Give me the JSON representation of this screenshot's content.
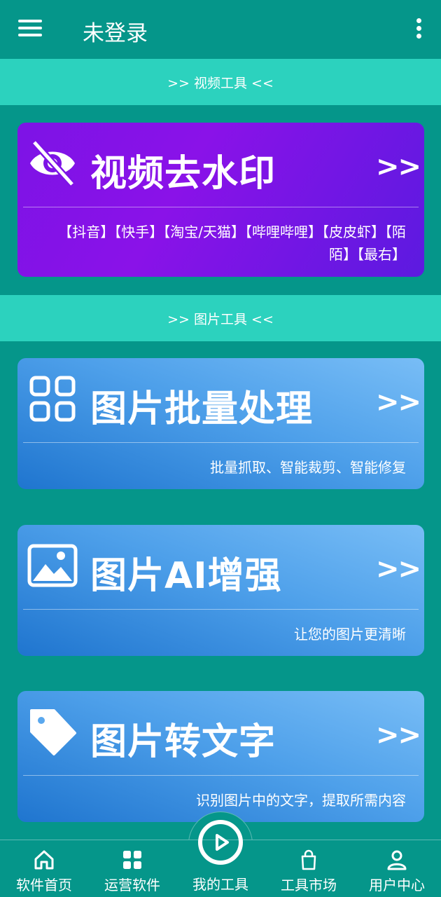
{
  "appbar": {
    "title": "未登录",
    "menu_icon": "menu-icon",
    "more_icon": "more-vert-icon"
  },
  "sections": {
    "video": ">> 视频工具 <<",
    "image": ">> 图片工具 <<"
  },
  "cards": [
    {
      "title": "视频去水印",
      "arrows": ">>",
      "subtitle": "【抖音】【快手】【淘宝/天猫】【哔哩哔哩】【皮皮虾】【陌陌】【最右】",
      "icon": "eye-off-icon"
    },
    {
      "title": "图片批量处理",
      "arrows": ">>",
      "subtitle": "批量抓取、智能裁剪、智能修复",
      "icon": "grid-icon"
    },
    {
      "title": "图片AI增强",
      "arrows": ">>",
      "subtitle": "让您的图片更清晰",
      "icon": "image-icon"
    },
    {
      "title": "图片转文字",
      "arrows": ">>",
      "subtitle": "识别图片中的文字，提取所需内容",
      "icon": "tag-icon"
    }
  ],
  "bottom_nav": {
    "items": [
      {
        "label": "软件首页",
        "icon": "home-icon"
      },
      {
        "label": "运营软件",
        "icon": "apps-icon"
      },
      {
        "label": "我的工具",
        "icon": "play-circle-icon"
      },
      {
        "label": "工具市场",
        "icon": "shopping-bag-icon"
      },
      {
        "label": "用户中心",
        "icon": "user-icon"
      }
    ]
  },
  "colors": {
    "background": "#05968A",
    "section_bar": "#2CD2BE",
    "purple_card": "#7D13E6",
    "blue_card": "#4EA0EA"
  }
}
